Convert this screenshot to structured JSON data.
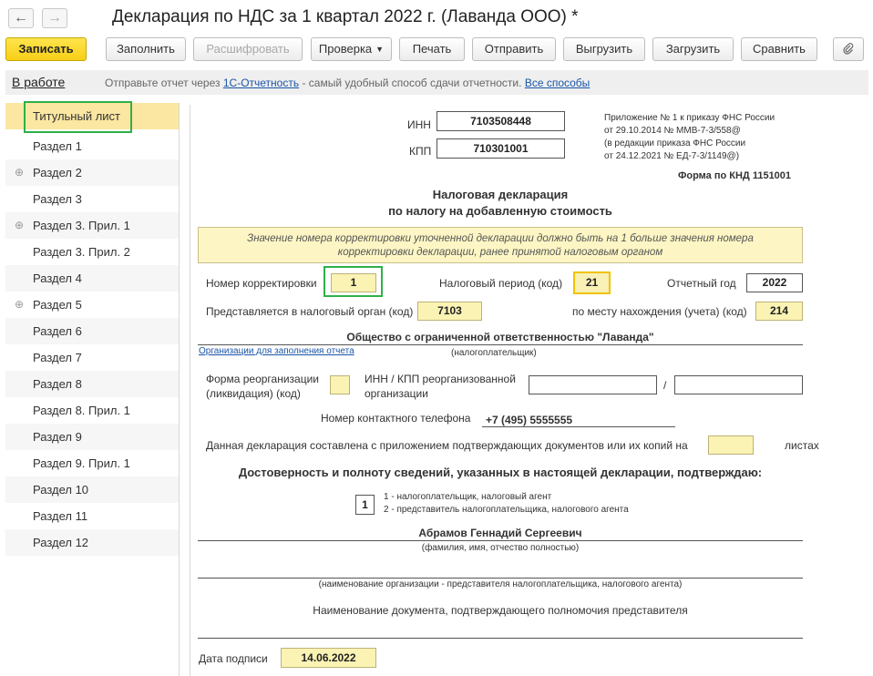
{
  "window": {
    "title": "Декларация по НДС за 1 квартал 2022 г. (Лаванда ООО) *"
  },
  "toolbar": {
    "save": "Записать",
    "fill": "Заполнить",
    "decrypt": "Расшифровать",
    "check": "Проверка",
    "print": "Печать",
    "send": "Отправить",
    "export": "Выгрузить",
    "import": "Загрузить",
    "compare": "Сравнить"
  },
  "infobar": {
    "status": "В работе",
    "text_before": "Отправьте отчет через",
    "link1": "1С-Отчетность",
    "text_middle": "- самый удобный способ сдачи отчетности.",
    "link2": "Все способы"
  },
  "sidebar": {
    "items": [
      {
        "label": "Титульный лист"
      },
      {
        "label": "Раздел 1"
      },
      {
        "label": "Раздел 2"
      },
      {
        "label": "Раздел 3"
      },
      {
        "label": "Раздел 3. Прил. 1"
      },
      {
        "label": "Раздел 3. Прил. 2"
      },
      {
        "label": "Раздел 4"
      },
      {
        "label": "Раздел 5"
      },
      {
        "label": "Раздел 6"
      },
      {
        "label": "Раздел 7"
      },
      {
        "label": "Раздел 8"
      },
      {
        "label": "Раздел 8. Прил. 1"
      },
      {
        "label": "Раздел 9"
      },
      {
        "label": "Раздел 9. Прил. 1"
      },
      {
        "label": "Раздел 10"
      },
      {
        "label": "Раздел 11"
      },
      {
        "label": "Раздел 12"
      }
    ]
  },
  "form": {
    "inn_label": "ИНН",
    "inn": "7103508448",
    "kpp_label": "КПП",
    "kpp": "710301001",
    "appendix_note": [
      "Приложение № 1 к приказу ФНС России",
      "от 29.10.2014 № ММВ-7-3/558@",
      "(в редакции приказа ФНС России",
      "от 24.12.2021 № ЕД-7-3/1149@)"
    ],
    "form_code": "Форма по КНД 1151001",
    "heading_line1": "Налоговая декларация",
    "heading_line2": "по налогу на добавленную стоимость",
    "warning_line1": "Значение номера корректировки уточненной декларации должно быть на 1 больше значения номера",
    "warning_line2": "корректировки декларации, ранее принятой налоговым органом",
    "correction_label": "Номер корректировки",
    "correction": "1",
    "period_label": "Налоговый период (код)",
    "period": "21",
    "year_label": "Отчетный год",
    "year": "2022",
    "tax_authority_label": "Представляется в налоговый орган (код)",
    "tax_authority": "7103",
    "location_label": "по месту нахождения (учета) (код)",
    "location": "214",
    "org_name": "Общество с ограниченной ответственностью \"Лаванда\"",
    "org_link": "Организации для заполнения отчета",
    "taxpayer_caption": "(налогоплательщик)",
    "reorg_label_1": "Форма реорганизации",
    "reorg_label_2": "(ликвидация) (код)",
    "reorg_inn_label_1": "ИНН / КПП реорганизованной",
    "reorg_inn_label_2": "организации",
    "slash": "/",
    "phone_label": "Номер контактного телефона",
    "phone": "+7 (495) 5555555",
    "pages_label": "Данная декларация составлена с приложением подтверждающих документов или их копий на",
    "pages_suffix": "листах",
    "confirm_heading": "Достоверность и полноту сведений, указанных в настоящей декларации, подтверждаю:",
    "signer_code": "1",
    "signer_option1": "1 - налогоплательщик, налоговый агент",
    "signer_option2": "2 - представитель налогоплательщика, налогового агента",
    "signer_name": "Абрамов Геннадий Сергеевич",
    "fio_caption": "(фамилия, имя, отчество полностью)",
    "rep_org_caption": "(наименование организации - представителя налогоплательщика, налогового агента)",
    "doc_caption": "Наименование документа, подтверждающего полномочия представителя",
    "sign_date_label": "Дата подписи",
    "sign_date": "14.06.2022"
  },
  "colors": {
    "accent_yellow": "#f7cf16",
    "field_yellow": "#fbf3b4",
    "selection": "#fbe7a1",
    "highlight_green": "#2fb04a",
    "link_blue": "#1a55a8"
  }
}
